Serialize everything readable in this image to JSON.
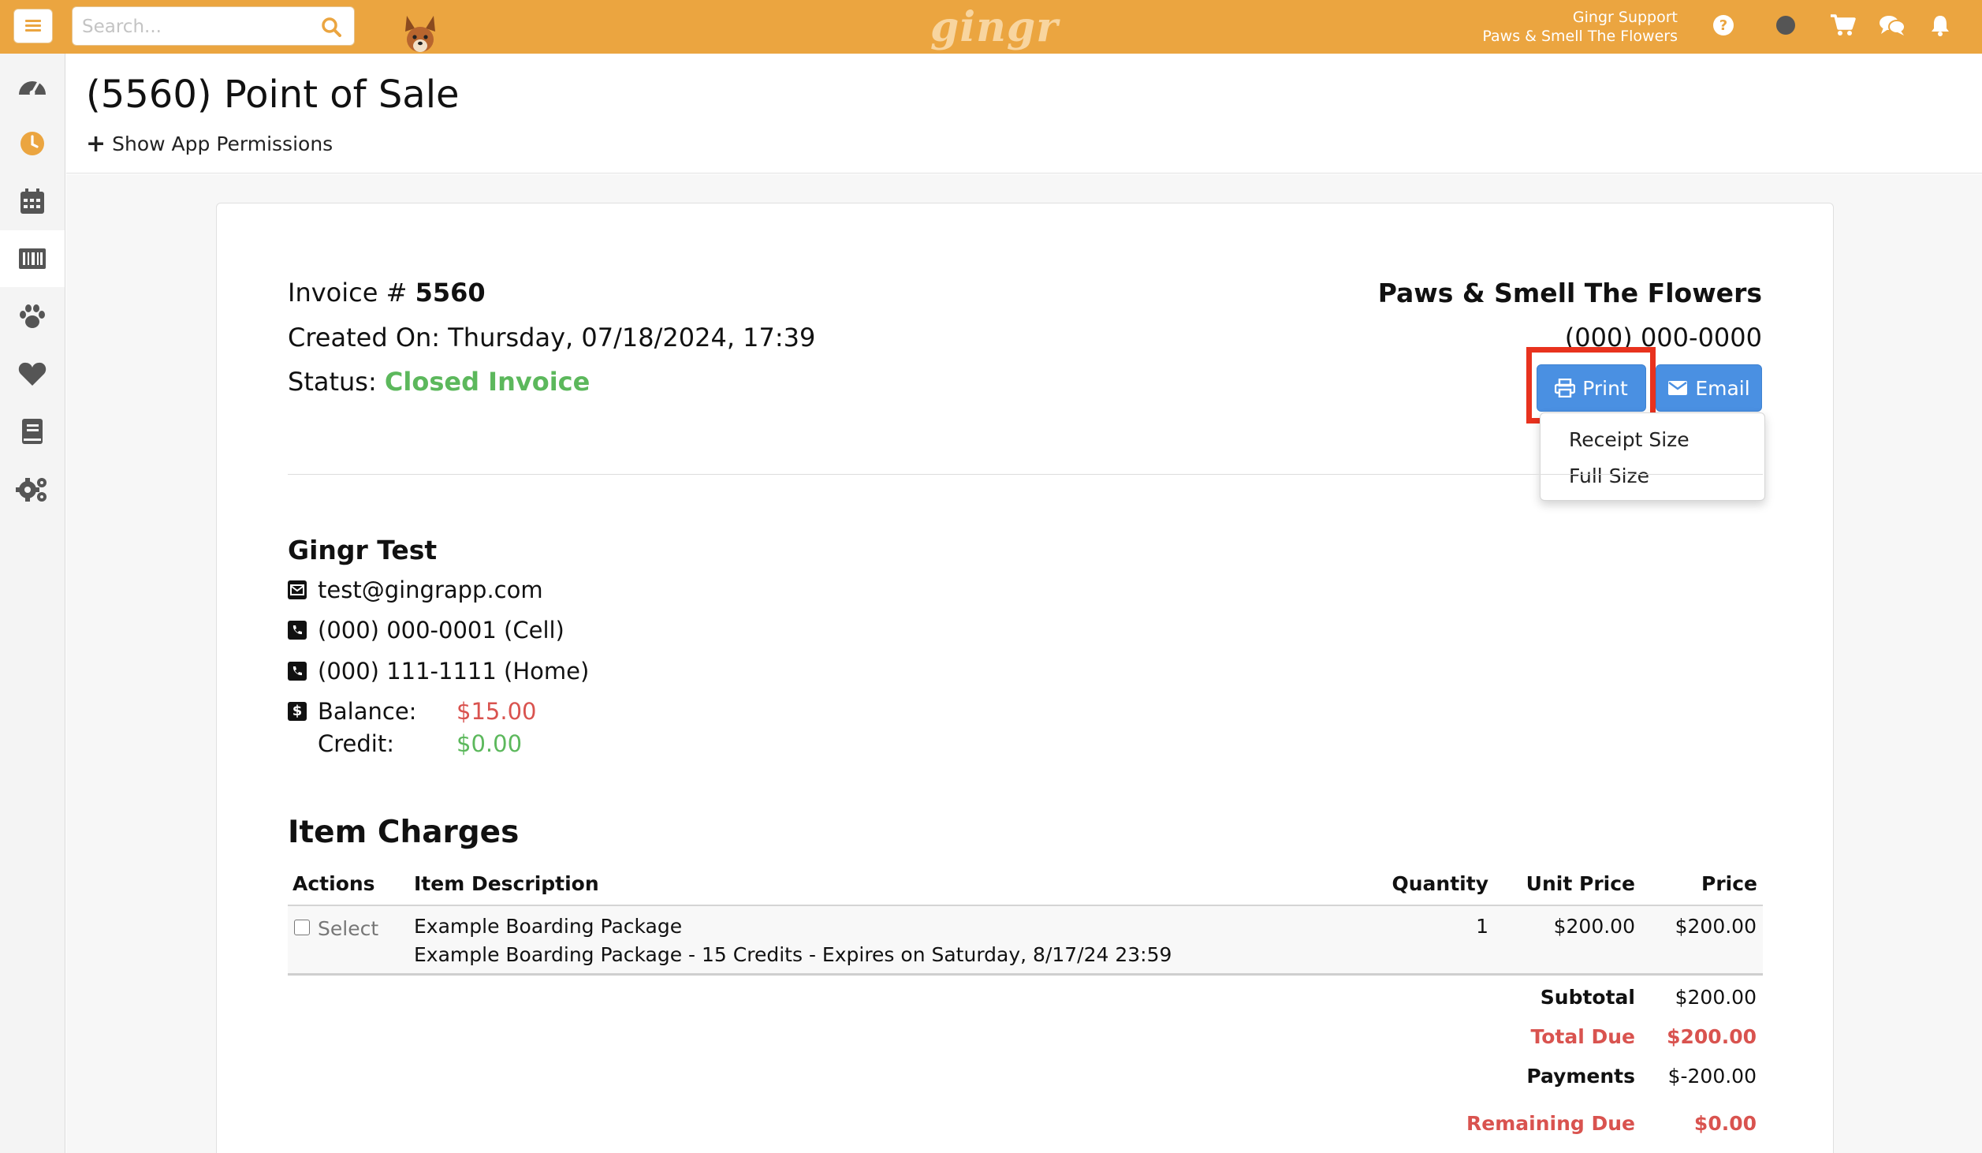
{
  "topbar": {
    "search_placeholder": "Search...",
    "logo": "gingr",
    "user_name": "Gingr Support",
    "user_location": "Paws & Smell The Flowers"
  },
  "page": {
    "title": "(5560) Point of Sale",
    "permissions_label": "Show App Permissions"
  },
  "invoice": {
    "number_label": "Invoice #",
    "number": "5560",
    "created_label": "Created On:",
    "created_value": "Thursday, 07/18/2024, 17:39",
    "status_label": "Status:",
    "status_value": "Closed Invoice",
    "business_name": "Paws & Smell The Flowers",
    "business_phone": "(000) 000-0000",
    "print_label": "Print",
    "email_label": "Email",
    "print_options": [
      "Receipt Size",
      "Full Size"
    ]
  },
  "customer": {
    "name": "Gingr Test",
    "email": "test@gingrapp.com",
    "cell": "(000) 000-0001 (Cell)",
    "home": "(000) 111-1111 (Home)",
    "balance_label": "Balance:",
    "balance_value": "$15.00",
    "credit_label": "Credit:",
    "credit_value": "$0.00"
  },
  "charges": {
    "title": "Item Charges",
    "headers": [
      "Actions",
      "Item Description",
      "Quantity",
      "Unit Price",
      "Price"
    ],
    "rows": [
      {
        "select_label": "Select",
        "description": "Example Boarding Package",
        "sub_description": "Example Boarding Package - 15 Credits - Expires on Saturday, 8/17/24 23:59",
        "quantity": "1",
        "unit_price": "$200.00",
        "price": "$200.00"
      }
    ],
    "totals": {
      "subtotal_label": "Subtotal",
      "subtotal_value": "$200.00",
      "total_due_label": "Total Due",
      "total_due_value": "$200.00",
      "payments_label": "Payments",
      "payments_value": "$-200.00",
      "remaining_label": "Remaining Due",
      "remaining_value": "$0.00"
    }
  },
  "colors": {
    "topbar": "#eba540",
    "primary_button": "#4a90e2",
    "status_green": "#5cb85c",
    "due_red": "#d9534f",
    "highlight_red": "#e8321e"
  }
}
